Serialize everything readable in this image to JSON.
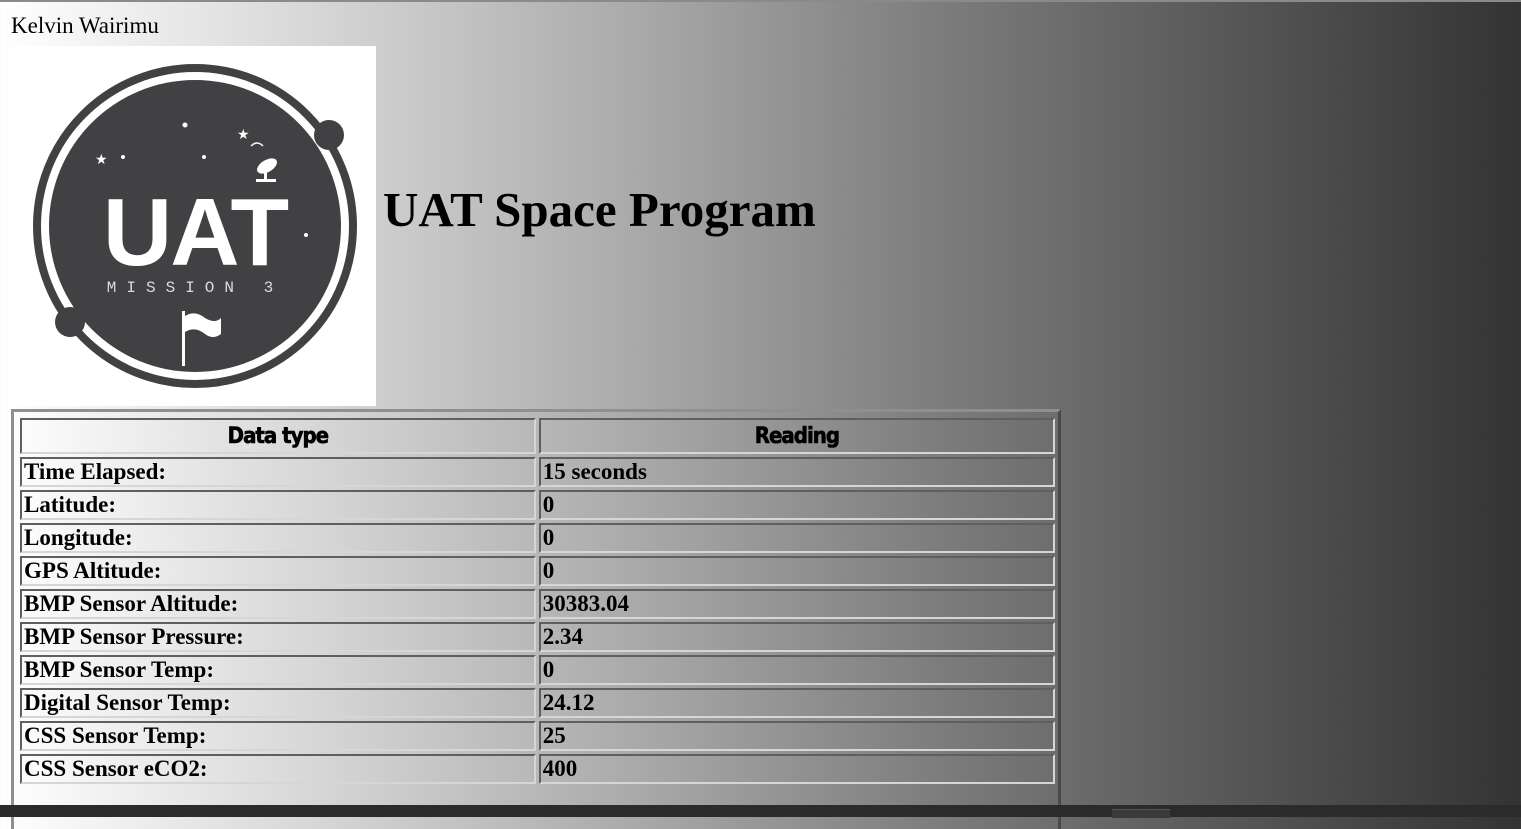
{
  "author": "Kelvin Wairimu",
  "logo": {
    "main_text": "UAT",
    "sub_text": "MISSION 3"
  },
  "title": "UAT Space Program",
  "table": {
    "headers": [
      "Data type",
      "Reading"
    ],
    "rows": [
      {
        "label": "Time Elapsed:",
        "value": "15 seconds"
      },
      {
        "label": "Latitude:",
        "value": "0"
      },
      {
        "label": "Longitude:",
        "value": "0"
      },
      {
        "label": "GPS Altitude:",
        "value": "0"
      },
      {
        "label": "BMP Sensor Altitude:",
        "value": "30383.04"
      },
      {
        "label": "BMP Sensor Pressure:",
        "value": "2.34"
      },
      {
        "label": "BMP Sensor Temp:",
        "value": "0"
      },
      {
        "label": "Digital Sensor Temp:",
        "value": "24.12"
      },
      {
        "label": "CSS Sensor Temp:",
        "value": "25"
      },
      {
        "label": "CSS Sensor eCO2:",
        "value": "400"
      }
    ]
  }
}
